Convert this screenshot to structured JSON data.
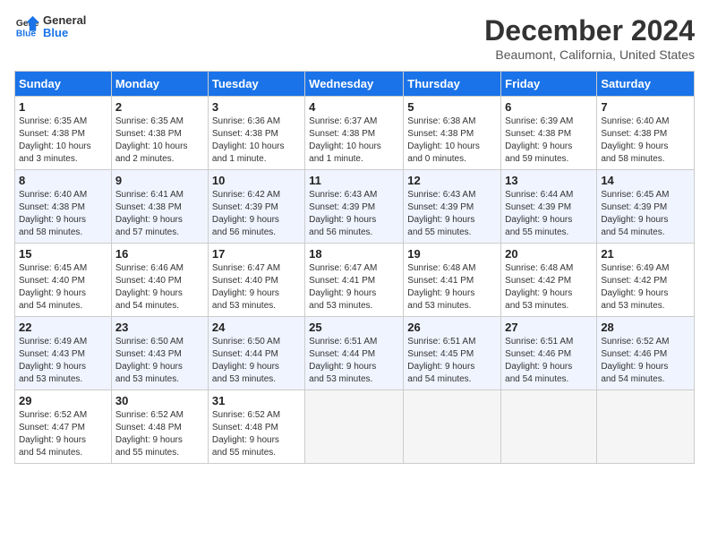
{
  "logo": {
    "line1": "General",
    "line2": "Blue"
  },
  "title": "December 2024",
  "subtitle": "Beaumont, California, United States",
  "days_of_week": [
    "Sunday",
    "Monday",
    "Tuesday",
    "Wednesday",
    "Thursday",
    "Friday",
    "Saturday"
  ],
  "weeks": [
    [
      {
        "day": "1",
        "info": "Sunrise: 6:35 AM\nSunset: 4:38 PM\nDaylight: 10 hours\nand 3 minutes."
      },
      {
        "day": "2",
        "info": "Sunrise: 6:35 AM\nSunset: 4:38 PM\nDaylight: 10 hours\nand 2 minutes."
      },
      {
        "day": "3",
        "info": "Sunrise: 6:36 AM\nSunset: 4:38 PM\nDaylight: 10 hours\nand 1 minute."
      },
      {
        "day": "4",
        "info": "Sunrise: 6:37 AM\nSunset: 4:38 PM\nDaylight: 10 hours\nand 1 minute."
      },
      {
        "day": "5",
        "info": "Sunrise: 6:38 AM\nSunset: 4:38 PM\nDaylight: 10 hours\nand 0 minutes."
      },
      {
        "day": "6",
        "info": "Sunrise: 6:39 AM\nSunset: 4:38 PM\nDaylight: 9 hours\nand 59 minutes."
      },
      {
        "day": "7",
        "info": "Sunrise: 6:40 AM\nSunset: 4:38 PM\nDaylight: 9 hours\nand 58 minutes."
      }
    ],
    [
      {
        "day": "8",
        "info": "Sunrise: 6:40 AM\nSunset: 4:38 PM\nDaylight: 9 hours\nand 58 minutes."
      },
      {
        "day": "9",
        "info": "Sunrise: 6:41 AM\nSunset: 4:38 PM\nDaylight: 9 hours\nand 57 minutes."
      },
      {
        "day": "10",
        "info": "Sunrise: 6:42 AM\nSunset: 4:39 PM\nDaylight: 9 hours\nand 56 minutes."
      },
      {
        "day": "11",
        "info": "Sunrise: 6:43 AM\nSunset: 4:39 PM\nDaylight: 9 hours\nand 56 minutes."
      },
      {
        "day": "12",
        "info": "Sunrise: 6:43 AM\nSunset: 4:39 PM\nDaylight: 9 hours\nand 55 minutes."
      },
      {
        "day": "13",
        "info": "Sunrise: 6:44 AM\nSunset: 4:39 PM\nDaylight: 9 hours\nand 55 minutes."
      },
      {
        "day": "14",
        "info": "Sunrise: 6:45 AM\nSunset: 4:39 PM\nDaylight: 9 hours\nand 54 minutes."
      }
    ],
    [
      {
        "day": "15",
        "info": "Sunrise: 6:45 AM\nSunset: 4:40 PM\nDaylight: 9 hours\nand 54 minutes."
      },
      {
        "day": "16",
        "info": "Sunrise: 6:46 AM\nSunset: 4:40 PM\nDaylight: 9 hours\nand 54 minutes."
      },
      {
        "day": "17",
        "info": "Sunrise: 6:47 AM\nSunset: 4:40 PM\nDaylight: 9 hours\nand 53 minutes."
      },
      {
        "day": "18",
        "info": "Sunrise: 6:47 AM\nSunset: 4:41 PM\nDaylight: 9 hours\nand 53 minutes."
      },
      {
        "day": "19",
        "info": "Sunrise: 6:48 AM\nSunset: 4:41 PM\nDaylight: 9 hours\nand 53 minutes."
      },
      {
        "day": "20",
        "info": "Sunrise: 6:48 AM\nSunset: 4:42 PM\nDaylight: 9 hours\nand 53 minutes."
      },
      {
        "day": "21",
        "info": "Sunrise: 6:49 AM\nSunset: 4:42 PM\nDaylight: 9 hours\nand 53 minutes."
      }
    ],
    [
      {
        "day": "22",
        "info": "Sunrise: 6:49 AM\nSunset: 4:43 PM\nDaylight: 9 hours\nand 53 minutes."
      },
      {
        "day": "23",
        "info": "Sunrise: 6:50 AM\nSunset: 4:43 PM\nDaylight: 9 hours\nand 53 minutes."
      },
      {
        "day": "24",
        "info": "Sunrise: 6:50 AM\nSunset: 4:44 PM\nDaylight: 9 hours\nand 53 minutes."
      },
      {
        "day": "25",
        "info": "Sunrise: 6:51 AM\nSunset: 4:44 PM\nDaylight: 9 hours\nand 53 minutes."
      },
      {
        "day": "26",
        "info": "Sunrise: 6:51 AM\nSunset: 4:45 PM\nDaylight: 9 hours\nand 54 minutes."
      },
      {
        "day": "27",
        "info": "Sunrise: 6:51 AM\nSunset: 4:46 PM\nDaylight: 9 hours\nand 54 minutes."
      },
      {
        "day": "28",
        "info": "Sunrise: 6:52 AM\nSunset: 4:46 PM\nDaylight: 9 hours\nand 54 minutes."
      }
    ],
    [
      {
        "day": "29",
        "info": "Sunrise: 6:52 AM\nSunset: 4:47 PM\nDaylight: 9 hours\nand 54 minutes."
      },
      {
        "day": "30",
        "info": "Sunrise: 6:52 AM\nSunset: 4:48 PM\nDaylight: 9 hours\nand 55 minutes."
      },
      {
        "day": "31",
        "info": "Sunrise: 6:52 AM\nSunset: 4:48 PM\nDaylight: 9 hours\nand 55 minutes."
      },
      {
        "day": "",
        "info": ""
      },
      {
        "day": "",
        "info": ""
      },
      {
        "day": "",
        "info": ""
      },
      {
        "day": "",
        "info": ""
      }
    ]
  ]
}
